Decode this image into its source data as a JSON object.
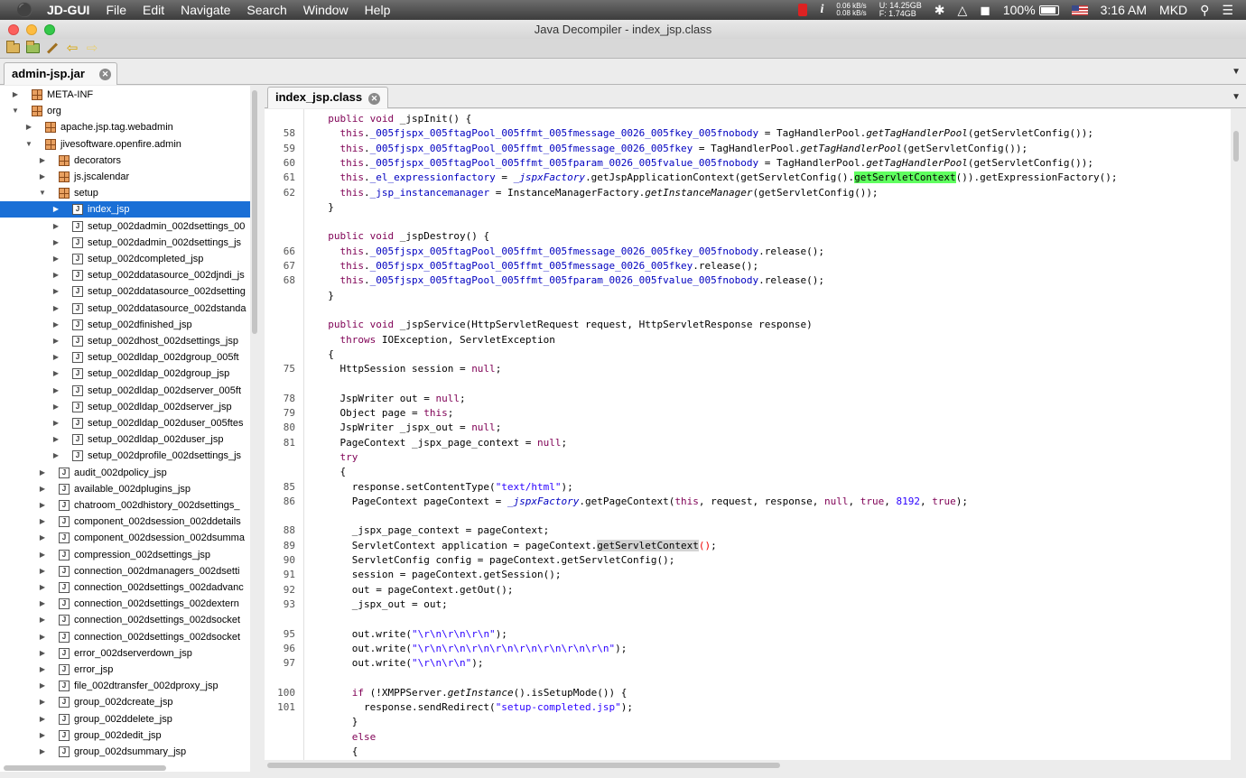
{
  "menubar": {
    "app_name": "JD-GUI",
    "items": [
      "File",
      "Edit",
      "Navigate",
      "Search",
      "Window",
      "Help"
    ],
    "net_up": "0.06 kB/s",
    "net_down": "0.08 kB/s",
    "mem_used": "U: 14.25GB",
    "mem_free": "F: 1.74GB",
    "battery": "100%",
    "time": "3:16 AM",
    "user": "MKD"
  },
  "window": {
    "title": "Java Decompiler - index_jsp.class"
  },
  "left_tab": {
    "label": "admin-jsp.jar"
  },
  "editor_tab": {
    "label": "index_jsp.class"
  },
  "tree": [
    {
      "label": "META-INF",
      "icon": "package",
      "depth": 0,
      "expanded": false
    },
    {
      "label": "org",
      "icon": "package",
      "depth": 0,
      "expanded": true
    },
    {
      "label": "apache.jsp.tag.webadmin",
      "icon": "package",
      "depth": 1,
      "expanded": false
    },
    {
      "label": "jivesoftware.openfire.admin",
      "icon": "package",
      "depth": 1,
      "expanded": true
    },
    {
      "label": "decorators",
      "icon": "package",
      "depth": 2,
      "expanded": false
    },
    {
      "label": "js.jscalendar",
      "icon": "package",
      "depth": 2,
      "expanded": false
    },
    {
      "label": "setup",
      "icon": "package",
      "depth": 2,
      "expanded": true
    },
    {
      "label": "index_jsp",
      "icon": "class-file",
      "depth": 3,
      "expanded": false,
      "selected": true
    },
    {
      "label": "setup_002dadmin_002dsettings_00",
      "icon": "class-file",
      "depth": 3,
      "expanded": false
    },
    {
      "label": "setup_002dadmin_002dsettings_js",
      "icon": "class-file",
      "depth": 3,
      "expanded": false
    },
    {
      "label": "setup_002dcompleted_jsp",
      "icon": "class-file",
      "depth": 3,
      "expanded": false
    },
    {
      "label": "setup_002ddatasource_002djndi_js",
      "icon": "class-file",
      "depth": 3,
      "expanded": false
    },
    {
      "label": "setup_002ddatasource_002dsetting",
      "icon": "class-file",
      "depth": 3,
      "expanded": false
    },
    {
      "label": "setup_002ddatasource_002dstanda",
      "icon": "class-file",
      "depth": 3,
      "expanded": false
    },
    {
      "label": "setup_002dfinished_jsp",
      "icon": "class-file",
      "depth": 3,
      "expanded": false
    },
    {
      "label": "setup_002dhost_002dsettings_jsp",
      "icon": "class-file",
      "depth": 3,
      "expanded": false
    },
    {
      "label": "setup_002dldap_002dgroup_005ft",
      "icon": "class-file",
      "depth": 3,
      "expanded": false
    },
    {
      "label": "setup_002dldap_002dgroup_jsp",
      "icon": "class-file",
      "depth": 3,
      "expanded": false
    },
    {
      "label": "setup_002dldap_002dserver_005ft",
      "icon": "class-file",
      "depth": 3,
      "expanded": false
    },
    {
      "label": "setup_002dldap_002dserver_jsp",
      "icon": "class-file",
      "depth": 3,
      "expanded": false
    },
    {
      "label": "setup_002dldap_002duser_005ftes",
      "icon": "class-file",
      "depth": 3,
      "expanded": false
    },
    {
      "label": "setup_002dldap_002duser_jsp",
      "icon": "class-file",
      "depth": 3,
      "expanded": false
    },
    {
      "label": "setup_002dprofile_002dsettings_js",
      "icon": "class-file",
      "depth": 3,
      "expanded": false
    },
    {
      "label": "audit_002dpolicy_jsp",
      "icon": "class-file",
      "depth": 2,
      "expanded": false
    },
    {
      "label": "available_002dplugins_jsp",
      "icon": "class-file",
      "depth": 2,
      "expanded": false
    },
    {
      "label": "chatroom_002dhistory_002dsettings_",
      "icon": "class-file",
      "depth": 2,
      "expanded": false
    },
    {
      "label": "component_002dsession_002ddetails",
      "icon": "class-file",
      "depth": 2,
      "expanded": false
    },
    {
      "label": "component_002dsession_002dsumma",
      "icon": "class-file",
      "depth": 2,
      "expanded": false
    },
    {
      "label": "compression_002dsettings_jsp",
      "icon": "class-file",
      "depth": 2,
      "expanded": false
    },
    {
      "label": "connection_002dmanagers_002dsetti",
      "icon": "class-file",
      "depth": 2,
      "expanded": false
    },
    {
      "label": "connection_002dsettings_002dadvanc",
      "icon": "class-file",
      "depth": 2,
      "expanded": false
    },
    {
      "label": "connection_002dsettings_002dextern",
      "icon": "class-file",
      "depth": 2,
      "expanded": false
    },
    {
      "label": "connection_002dsettings_002dsocket",
      "icon": "class-file",
      "depth": 2,
      "expanded": false
    },
    {
      "label": "connection_002dsettings_002dsocket",
      "icon": "class-file",
      "depth": 2,
      "expanded": false
    },
    {
      "label": "error_002dserverdown_jsp",
      "icon": "class-file",
      "depth": 2,
      "expanded": false
    },
    {
      "label": "error_jsp",
      "icon": "class-file",
      "depth": 2,
      "expanded": false
    },
    {
      "label": "file_002dtransfer_002dproxy_jsp",
      "icon": "class-file",
      "depth": 2,
      "expanded": false
    },
    {
      "label": "group_002dcreate_jsp",
      "icon": "class-file",
      "depth": 2,
      "expanded": false
    },
    {
      "label": "group_002ddelete_jsp",
      "icon": "class-file",
      "depth": 2,
      "expanded": false
    },
    {
      "label": "group_002dedit_jsp",
      "icon": "class-file",
      "depth": 2,
      "expanded": false
    },
    {
      "label": "group_002dsummary_jsp",
      "icon": "class-file",
      "depth": 2,
      "expanded": false
    }
  ],
  "code_lines": [
    {
      "no": "",
      "tokens": [
        [
          "  ",
          ""
        ],
        [
          "public void",
          "kw"
        ],
        [
          " _jspInit() {",
          ""
        ]
      ]
    },
    {
      "no": "58",
      "tokens": [
        [
          "    ",
          ""
        ],
        [
          "this",
          "kw"
        ],
        [
          ".",
          ""
        ],
        [
          "_005fjspx_005ftagPool_005ffmt_005fmessage_0026_005fkey_005fnobody",
          "fld"
        ],
        [
          " = TagHandlerPool.",
          ""
        ],
        [
          "getTagHandlerPool",
          "it"
        ],
        [
          "(getServletConfig());",
          ""
        ]
      ]
    },
    {
      "no": "59",
      "tokens": [
        [
          "    ",
          ""
        ],
        [
          "this",
          "kw"
        ],
        [
          ".",
          ""
        ],
        [
          "_005fjspx_005ftagPool_005ffmt_005fmessage_0026_005fkey",
          "fld"
        ],
        [
          " = TagHandlerPool.",
          ""
        ],
        [
          "getTagHandlerPool",
          "it"
        ],
        [
          "(getServletConfig());",
          ""
        ]
      ]
    },
    {
      "no": "60",
      "tokens": [
        [
          "    ",
          ""
        ],
        [
          "this",
          "kw"
        ],
        [
          ".",
          ""
        ],
        [
          "_005fjspx_005ftagPool_005ffmt_005fparam_0026_005fvalue_005fnobody",
          "fld"
        ],
        [
          " = TagHandlerPool.",
          ""
        ],
        [
          "getTagHandlerPool",
          "it"
        ],
        [
          "(getServletConfig());",
          ""
        ]
      ]
    },
    {
      "no": "61",
      "tokens": [
        [
          "    ",
          ""
        ],
        [
          "this",
          "kw"
        ],
        [
          ".",
          ""
        ],
        [
          "_el_expressionfactory",
          "fld"
        ],
        [
          " = ",
          ""
        ],
        [
          "_jspxFactory",
          "fld it"
        ],
        [
          ".getJspApplicationContext(getServletConfig().",
          ""
        ],
        [
          "getServletContext",
          "hlg"
        ],
        [
          "()).getExpressionFactory();",
          ""
        ]
      ]
    },
    {
      "no": "62",
      "tokens": [
        [
          "    ",
          ""
        ],
        [
          "this",
          "kw"
        ],
        [
          ".",
          ""
        ],
        [
          "_jsp_instancemanager",
          "fld"
        ],
        [
          " = InstanceManagerFactory.",
          ""
        ],
        [
          "getInstanceManager",
          "it"
        ],
        [
          "(getServletConfig());",
          ""
        ]
      ]
    },
    {
      "no": "",
      "tokens": [
        [
          "  }",
          ""
        ]
      ]
    },
    {
      "no": "",
      "tokens": [
        [
          "",
          ""
        ]
      ]
    },
    {
      "no": "",
      "tokens": [
        [
          "  ",
          ""
        ],
        [
          "public void",
          "kw"
        ],
        [
          " _jspDestroy() {",
          ""
        ]
      ]
    },
    {
      "no": "66",
      "tokens": [
        [
          "    ",
          ""
        ],
        [
          "this",
          "kw"
        ],
        [
          ".",
          ""
        ],
        [
          "_005fjspx_005ftagPool_005ffmt_005fmessage_0026_005fkey_005fnobody",
          "fld"
        ],
        [
          ".release();",
          ""
        ]
      ]
    },
    {
      "no": "67",
      "tokens": [
        [
          "    ",
          ""
        ],
        [
          "this",
          "kw"
        ],
        [
          ".",
          ""
        ],
        [
          "_005fjspx_005ftagPool_005ffmt_005fmessage_0026_005fkey",
          "fld"
        ],
        [
          ".release();",
          ""
        ]
      ]
    },
    {
      "no": "68",
      "tokens": [
        [
          "    ",
          ""
        ],
        [
          "this",
          "kw"
        ],
        [
          ".",
          ""
        ],
        [
          "_005fjspx_005ftagPool_005ffmt_005fparam_0026_005fvalue_005fnobody",
          "fld"
        ],
        [
          ".release();",
          ""
        ]
      ]
    },
    {
      "no": "",
      "tokens": [
        [
          "  }",
          ""
        ]
      ]
    },
    {
      "no": "",
      "tokens": [
        [
          "",
          ""
        ]
      ]
    },
    {
      "no": "",
      "tokens": [
        [
          "  ",
          ""
        ],
        [
          "public void",
          "kw"
        ],
        [
          " _jspService(HttpServletRequest request, HttpServletResponse response)",
          ""
        ]
      ]
    },
    {
      "no": "",
      "tokens": [
        [
          "    ",
          ""
        ],
        [
          "throws",
          "kw"
        ],
        [
          " IOException, ServletException",
          ""
        ]
      ]
    },
    {
      "no": "",
      "tokens": [
        [
          "  {",
          ""
        ]
      ]
    },
    {
      "no": "75",
      "tokens": [
        [
          "    HttpSession session = ",
          ""
        ],
        [
          "null",
          "kw"
        ],
        [
          ";",
          ""
        ]
      ]
    },
    {
      "no": "",
      "tokens": [
        [
          "",
          ""
        ]
      ]
    },
    {
      "no": "78",
      "tokens": [
        [
          "    JspWriter out = ",
          ""
        ],
        [
          "null",
          "kw"
        ],
        [
          ";",
          ""
        ]
      ]
    },
    {
      "no": "79",
      "tokens": [
        [
          "    Object page = ",
          ""
        ],
        [
          "this",
          "kw"
        ],
        [
          ";",
          ""
        ]
      ]
    },
    {
      "no": "80",
      "tokens": [
        [
          "    JspWriter _jspx_out = ",
          ""
        ],
        [
          "null",
          "kw"
        ],
        [
          ";",
          ""
        ]
      ]
    },
    {
      "no": "81",
      "tokens": [
        [
          "    PageContext _jspx_page_context = ",
          ""
        ],
        [
          "null",
          "kw"
        ],
        [
          ";",
          ""
        ]
      ]
    },
    {
      "no": "",
      "tokens": [
        [
          "    ",
          ""
        ],
        [
          "try",
          "kw"
        ]
      ]
    },
    {
      "no": "",
      "tokens": [
        [
          "    {",
          ""
        ]
      ]
    },
    {
      "no": "85",
      "tokens": [
        [
          "      response.setContentType(",
          ""
        ],
        [
          "\"text/html\"",
          "str"
        ],
        [
          ");",
          ""
        ]
      ]
    },
    {
      "no": "86",
      "tokens": [
        [
          "      PageContext pageContext = ",
          ""
        ],
        [
          "_jspxFactory",
          "fld it"
        ],
        [
          ".getPageContext(",
          ""
        ],
        [
          "this",
          "kw"
        ],
        [
          ", request, response, ",
          ""
        ],
        [
          "null",
          "kw"
        ],
        [
          ", ",
          ""
        ],
        [
          "true",
          "kw"
        ],
        [
          ", ",
          ""
        ],
        [
          "8192",
          "num"
        ],
        [
          ", ",
          ""
        ],
        [
          "true",
          "kw"
        ],
        [
          ");",
          ""
        ]
      ]
    },
    {
      "no": "",
      "tokens": [
        [
          "",
          ""
        ]
      ]
    },
    {
      "no": "88",
      "tokens": [
        [
          "      _jspx_page_context = pageContext;",
          ""
        ]
      ]
    },
    {
      "no": "89",
      "tokens": [
        [
          "      ServletContext application = pageContext.",
          ""
        ],
        [
          "getServletContext",
          "hlr"
        ],
        [
          "()",
          "red"
        ],
        [
          ";",
          ""
        ]
      ]
    },
    {
      "no": "90",
      "tokens": [
        [
          "      ServletConfig config = pageContext.getServletConfig();",
          ""
        ]
      ]
    },
    {
      "no": "91",
      "tokens": [
        [
          "      session = pageContext.getSession();",
          ""
        ]
      ]
    },
    {
      "no": "92",
      "tokens": [
        [
          "      out = pageContext.getOut();",
          ""
        ]
      ]
    },
    {
      "no": "93",
      "tokens": [
        [
          "      _jspx_out = out;",
          ""
        ]
      ]
    },
    {
      "no": "",
      "tokens": [
        [
          "",
          ""
        ]
      ]
    },
    {
      "no": "95",
      "tokens": [
        [
          "      out.write(",
          ""
        ],
        [
          "\"\\r\\n\\r\\n\\r\\n\"",
          "str"
        ],
        [
          ");",
          ""
        ]
      ]
    },
    {
      "no": "96",
      "tokens": [
        [
          "      out.write(",
          ""
        ],
        [
          "\"\\r\\n\\r\\n\\r\\n\\r\\n\\r\\n\\r\\n\\r\\n\\r\\n\"",
          "str"
        ],
        [
          ");",
          ""
        ]
      ]
    },
    {
      "no": "97",
      "tokens": [
        [
          "      out.write(",
          ""
        ],
        [
          "\"\\r\\n\\r\\n\"",
          "str"
        ],
        [
          ");",
          ""
        ]
      ]
    },
    {
      "no": "",
      "tokens": [
        [
          "",
          ""
        ]
      ]
    },
    {
      "no": "100",
      "tokens": [
        [
          "      ",
          ""
        ],
        [
          "if",
          "kw"
        ],
        [
          " (!XMPPServer.",
          ""
        ],
        [
          "getInstance",
          "it"
        ],
        [
          "().isSetupMode()) {",
          ""
        ]
      ]
    },
    {
      "no": "101",
      "tokens": [
        [
          "        response.sendRedirect(",
          ""
        ],
        [
          "\"setup-completed.jsp\"",
          "str"
        ],
        [
          ");",
          ""
        ]
      ]
    },
    {
      "no": "",
      "tokens": [
        [
          "      }",
          ""
        ]
      ]
    },
    {
      "no": "",
      "tokens": [
        [
          "      ",
          ""
        ],
        [
          "else",
          "kw"
        ]
      ]
    },
    {
      "no": "",
      "tokens": [
        [
          "      {",
          ""
        ]
      ]
    }
  ]
}
